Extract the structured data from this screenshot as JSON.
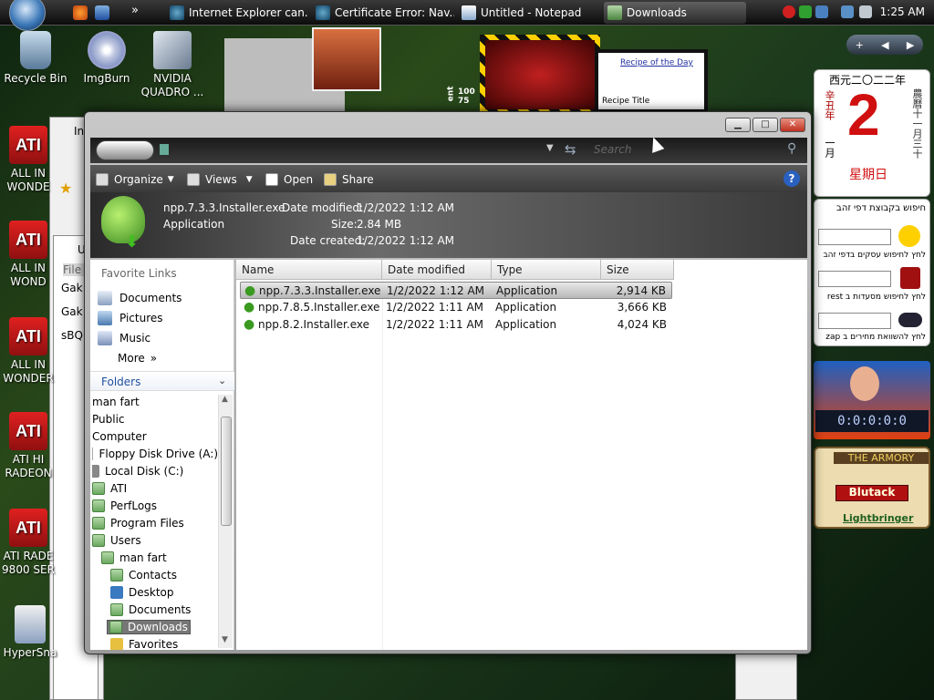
{
  "taskbar": {
    "buttons": [
      {
        "label": "Internet Explorer can..."
      },
      {
        "label": "Certificate Error: Nav..."
      },
      {
        "label": "Untitled - Notepad"
      },
      {
        "label": "Downloads"
      }
    ],
    "clock": "1:25 AM",
    "overflow": "»"
  },
  "desktop": {
    "icons": [
      {
        "label": "Recycle Bin"
      },
      {
        "label": "ImgBurn"
      },
      {
        "label": "NVIDIA QUADRO ..."
      },
      {
        "label": "ALL IN WONDE"
      },
      {
        "label": "ALL IN WOND"
      },
      {
        "label": "ALL IN WONDER"
      },
      {
        "label": "ATI HI RADEON"
      },
      {
        "label": "ATI RADE 9800 SER"
      },
      {
        "label": "HyperSna"
      }
    ],
    "ati_glyph": "ATI",
    "bg_texts": [
      "Gak",
      "Gak",
      "sBQ",
      "File",
      "In",
      "U",
      "In"
    ]
  },
  "recipe_gadget": {
    "link": "Recipe of the Day",
    "title": "Recipe Title"
  },
  "game_gadget": {
    "values": [
      "100",
      "75"
    ],
    "side": "ent"
  },
  "sidebar": {
    "calendar": {
      "year": "西元二〇二二年",
      "day": "2",
      "weekday": "星期日",
      "left": "辛丑年",
      "right": "農曆十一月三十",
      "month": "一月"
    },
    "search": {
      "header": "חיפוש בקבוצת דפי זהב",
      "hint1": "לחץ לחיפוש עסקים בדפי זהב",
      "hint2": "לחץ לחיפוש מסעדות ב rest",
      "hint3": "לחץ להשוואת מחירים ב zap"
    },
    "counter": "0:0:0:0:0",
    "armory": {
      "title": "THE ARMORY",
      "item": "Blutack",
      "link": "Lightbringer"
    }
  },
  "explorer": {
    "search_placeholder": "Search",
    "toolbar": {
      "organize": "Organize",
      "views": "Views",
      "open": "Open",
      "share": "Share"
    },
    "details": {
      "filename": "npp.7.3.3.Installer.exe",
      "type": "Application",
      "modified_label": "Date modified:",
      "modified": "1/2/2022 1:12 AM",
      "size_label": "Size:",
      "size": "2.84 MB",
      "created_label": "Date created:",
      "created": "1/2/2022 1:12 AM"
    },
    "favorites_header": "Favorite Links",
    "favorites": [
      "Documents",
      "Pictures",
      "Music",
      "More"
    ],
    "folders_header": "Folders",
    "tree": [
      "man fart",
      "Public",
      "Computer",
      "Floppy Disk Drive (A:)",
      "Local Disk (C:)",
      "ATI",
      "PerfLogs",
      "Program Files",
      "Users",
      "man fart",
      "Contacts",
      "Desktop",
      "Documents",
      "Downloads",
      "Favorites"
    ],
    "columns": [
      "Name",
      "Date modified",
      "Type",
      "Size"
    ],
    "files": [
      {
        "name": "npp.7.3.3.Installer.exe",
        "date": "1/2/2022 1:12 AM",
        "type": "Application",
        "size": "2,914 KB"
      },
      {
        "name": "npp.7.8.5.Installer.exe",
        "date": "1/2/2022 1:11 AM",
        "type": "Application",
        "size": "3,666 KB"
      },
      {
        "name": "npp.8.2.Installer.exe",
        "date": "1/2/2022 1:11 AM",
        "type": "Application",
        "size": "4,024 KB"
      }
    ]
  }
}
